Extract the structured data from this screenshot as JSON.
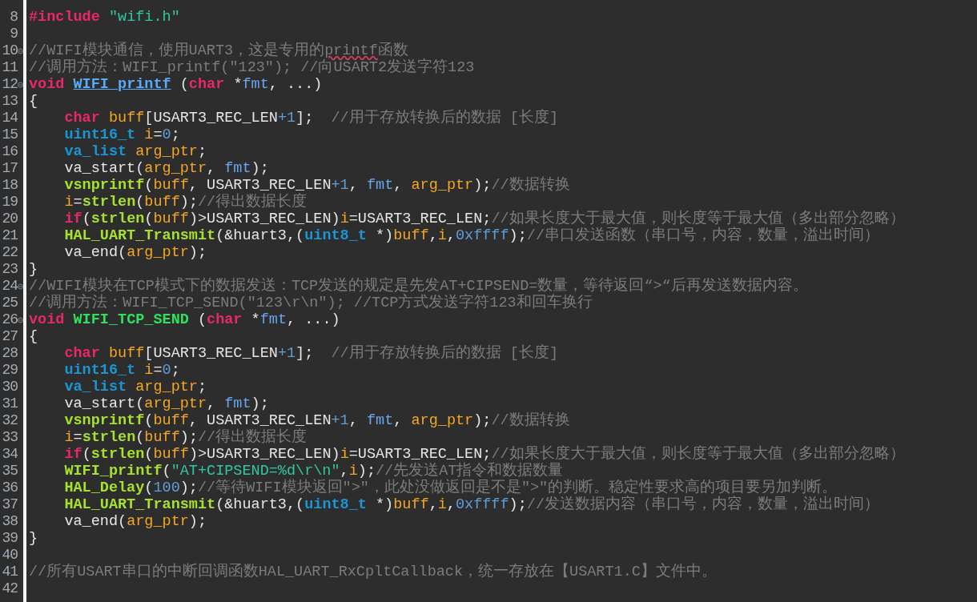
{
  "editor": {
    "lines": [
      {
        "number": "8",
        "fold": false,
        "tokens": [
          {
            "kind": "keyword",
            "text": "#include "
          },
          {
            "kind": "string",
            "text": "\"wifi.h\""
          }
        ]
      },
      {
        "number": "9",
        "fold": false
      },
      {
        "number": "10",
        "fold": true,
        "tokens": [
          {
            "kind": "comment",
            "text": "//WIFI模块通信，使用UART3，这是专用的"
          },
          {
            "kind": "misspelled",
            "text": "printf"
          },
          {
            "kind": "comment",
            "text": "函数"
          }
        ]
      },
      {
        "number": "11",
        "fold": false,
        "tokens": [
          {
            "kind": "comment",
            "text": "//调用方法：WIFI_printf(\"123\"); //向USART2发送字符123"
          }
        ]
      },
      {
        "number": "12",
        "fold": true,
        "tokens": [
          {
            "kind": "keyword",
            "text": "void "
          },
          {
            "kind": "definition-link",
            "text": "WIFI_printf"
          },
          {
            "kind": "plain",
            "text": " ("
          },
          {
            "kind": "keyword",
            "text": "char"
          },
          {
            "kind": "plain",
            "text": " *"
          },
          {
            "kind": "param",
            "text": "fmt"
          },
          {
            "kind": "plain",
            "text": ", ...)"
          }
        ]
      },
      {
        "number": "13",
        "fold": false,
        "tokens": [
          {
            "kind": "plain",
            "text": "{"
          }
        ]
      },
      {
        "number": "14",
        "fold": false,
        "indent": true,
        "tokens": [
          {
            "kind": "keyword",
            "text": "char "
          },
          {
            "kind": "variable",
            "text": "buff"
          },
          {
            "kind": "plain",
            "text": "[USART3_REC_LEN"
          },
          {
            "kind": "number",
            "text": "+1"
          },
          {
            "kind": "plain",
            "text": "];  "
          },
          {
            "kind": "comment",
            "text": "//用于存放转换后的数据 [长度]"
          }
        ]
      },
      {
        "number": "15",
        "fold": false,
        "indent": true,
        "tokens": [
          {
            "kind": "type",
            "text": "uint16_t "
          },
          {
            "kind": "variable",
            "text": "i"
          },
          {
            "kind": "plain",
            "text": "="
          },
          {
            "kind": "number",
            "text": "0"
          },
          {
            "kind": "plain",
            "text": ";"
          }
        ]
      },
      {
        "number": "16",
        "fold": false,
        "indent": true,
        "tokens": [
          {
            "kind": "type",
            "text": "va_list "
          },
          {
            "kind": "variable",
            "text": "arg_ptr"
          },
          {
            "kind": "plain",
            "text": ";"
          }
        ]
      },
      {
        "number": "17",
        "fold": false,
        "indent": true,
        "tokens": [
          {
            "kind": "plain",
            "text": "va_start("
          },
          {
            "kind": "variable",
            "text": "arg_ptr"
          },
          {
            "kind": "plain",
            "text": ", "
          },
          {
            "kind": "param",
            "text": "fmt"
          },
          {
            "kind": "plain",
            "text": ");"
          }
        ]
      },
      {
        "number": "18",
        "fold": false,
        "indent": true,
        "tokens": [
          {
            "kind": "function",
            "text": "vsnprintf"
          },
          {
            "kind": "plain",
            "text": "("
          },
          {
            "kind": "variable",
            "text": "buff"
          },
          {
            "kind": "plain",
            "text": ", USART3_REC_LEN"
          },
          {
            "kind": "number",
            "text": "+1"
          },
          {
            "kind": "plain",
            "text": ", "
          },
          {
            "kind": "param",
            "text": "fmt"
          },
          {
            "kind": "plain",
            "text": ", "
          },
          {
            "kind": "variable",
            "text": "arg_ptr"
          },
          {
            "kind": "plain",
            "text": ");"
          },
          {
            "kind": "comment",
            "text": "//数据转换"
          }
        ]
      },
      {
        "number": "19",
        "fold": false,
        "indent": true,
        "tokens": [
          {
            "kind": "variable",
            "text": "i"
          },
          {
            "kind": "plain",
            "text": "="
          },
          {
            "kind": "function",
            "text": "strlen"
          },
          {
            "kind": "plain",
            "text": "("
          },
          {
            "kind": "variable",
            "text": "buff"
          },
          {
            "kind": "plain",
            "text": ");"
          },
          {
            "kind": "comment",
            "text": "//得出数据长度"
          }
        ]
      },
      {
        "number": "20",
        "fold": false,
        "indent": true,
        "tokens": [
          {
            "kind": "keyword",
            "text": "if"
          },
          {
            "kind": "plain",
            "text": "("
          },
          {
            "kind": "function",
            "text": "strlen"
          },
          {
            "kind": "plain",
            "text": "("
          },
          {
            "kind": "variable",
            "text": "buff"
          },
          {
            "kind": "plain",
            "text": ")>USART3_REC_LEN)"
          },
          {
            "kind": "variable",
            "text": "i"
          },
          {
            "kind": "plain",
            "text": "=USART3_REC_LEN;"
          },
          {
            "kind": "comment",
            "text": "//如果长度大于最大值，则长度等于最大值（多出部分忽略）"
          }
        ]
      },
      {
        "number": "21",
        "fold": false,
        "indent": true,
        "tokens": [
          {
            "kind": "function",
            "text": "HAL_UART_Transmit"
          },
          {
            "kind": "plain",
            "text": "(&huart3,("
          },
          {
            "kind": "type",
            "text": "uint8_t"
          },
          {
            "kind": "plain",
            "text": " *)"
          },
          {
            "kind": "variable",
            "text": "buff"
          },
          {
            "kind": "plain",
            "text": ","
          },
          {
            "kind": "variable",
            "text": "i"
          },
          {
            "kind": "plain",
            "text": ","
          },
          {
            "kind": "number",
            "text": "0xffff"
          },
          {
            "kind": "plain",
            "text": ");"
          },
          {
            "kind": "comment",
            "text": "//串口发送函数（串口号，内容，数量，溢出时间）"
          }
        ]
      },
      {
        "number": "22",
        "fold": false,
        "indent": true,
        "tokens": [
          {
            "kind": "plain",
            "text": "va_end("
          },
          {
            "kind": "variable",
            "text": "arg_ptr"
          },
          {
            "kind": "plain",
            "text": ");"
          }
        ]
      },
      {
        "number": "23",
        "fold": false,
        "tokens": [
          {
            "kind": "plain",
            "text": "}"
          }
        ]
      },
      {
        "number": "24",
        "fold": true,
        "tokens": [
          {
            "kind": "comment",
            "text": "//WIFI模块在TCP模式下的数据发送：TCP发送的规定是先发AT+CIPSEND=数量，等待返回“>“后再发送数据内容。"
          }
        ]
      },
      {
        "number": "25",
        "fold": false,
        "tokens": [
          {
            "kind": "comment",
            "text": "//调用方法：WIFI_TCP_SEND(\"123\\r\\n\"); //TCP方式发送字符123和回车换行"
          }
        ]
      },
      {
        "number": "26",
        "fold": true,
        "tokens": [
          {
            "kind": "keyword",
            "text": "void "
          },
          {
            "kind": "definition",
            "text": "WIFI_TCP_SEND"
          },
          {
            "kind": "plain",
            "text": " ("
          },
          {
            "kind": "keyword",
            "text": "char"
          },
          {
            "kind": "plain",
            "text": " *"
          },
          {
            "kind": "param",
            "text": "fmt"
          },
          {
            "kind": "plain",
            "text": ", ...)"
          }
        ]
      },
      {
        "number": "27",
        "fold": false,
        "tokens": [
          {
            "kind": "plain",
            "text": "{"
          }
        ]
      },
      {
        "number": "28",
        "fold": false,
        "indent": true,
        "tokens": [
          {
            "kind": "keyword",
            "text": "char "
          },
          {
            "kind": "variable",
            "text": "buff"
          },
          {
            "kind": "plain",
            "text": "[USART3_REC_LEN"
          },
          {
            "kind": "number",
            "text": "+1"
          },
          {
            "kind": "plain",
            "text": "];  "
          },
          {
            "kind": "comment",
            "text": "//用于存放转换后的数据 [长度]"
          }
        ]
      },
      {
        "number": "29",
        "fold": false,
        "indent": true,
        "tokens": [
          {
            "kind": "type",
            "text": "uint16_t "
          },
          {
            "kind": "variable",
            "text": "i"
          },
          {
            "kind": "plain",
            "text": "="
          },
          {
            "kind": "number",
            "text": "0"
          },
          {
            "kind": "plain",
            "text": ";"
          }
        ]
      },
      {
        "number": "30",
        "fold": false,
        "indent": true,
        "tokens": [
          {
            "kind": "type",
            "text": "va_list "
          },
          {
            "kind": "variable",
            "text": "arg_ptr"
          },
          {
            "kind": "plain",
            "text": ";"
          }
        ]
      },
      {
        "number": "31",
        "fold": false,
        "indent": true,
        "tokens": [
          {
            "kind": "plain",
            "text": "va_start("
          },
          {
            "kind": "variable",
            "text": "arg_ptr"
          },
          {
            "kind": "plain",
            "text": ", "
          },
          {
            "kind": "param",
            "text": "fmt"
          },
          {
            "kind": "plain",
            "text": ");"
          }
        ]
      },
      {
        "number": "32",
        "fold": false,
        "indent": true,
        "tokens": [
          {
            "kind": "function",
            "text": "vsnprintf"
          },
          {
            "kind": "plain",
            "text": "("
          },
          {
            "kind": "variable",
            "text": "buff"
          },
          {
            "kind": "plain",
            "text": ", USART3_REC_LEN"
          },
          {
            "kind": "number",
            "text": "+1"
          },
          {
            "kind": "plain",
            "text": ", "
          },
          {
            "kind": "param",
            "text": "fmt"
          },
          {
            "kind": "plain",
            "text": ", "
          },
          {
            "kind": "variable",
            "text": "arg_ptr"
          },
          {
            "kind": "plain",
            "text": ");"
          },
          {
            "kind": "comment",
            "text": "//数据转换"
          }
        ]
      },
      {
        "number": "33",
        "fold": false,
        "indent": true,
        "tokens": [
          {
            "kind": "variable",
            "text": "i"
          },
          {
            "kind": "plain",
            "text": "="
          },
          {
            "kind": "function",
            "text": "strlen"
          },
          {
            "kind": "plain",
            "text": "("
          },
          {
            "kind": "variable",
            "text": "buff"
          },
          {
            "kind": "plain",
            "text": ");"
          },
          {
            "kind": "comment",
            "text": "//得出数据长度"
          }
        ]
      },
      {
        "number": "34",
        "fold": false,
        "indent": true,
        "tokens": [
          {
            "kind": "keyword",
            "text": "if"
          },
          {
            "kind": "plain",
            "text": "("
          },
          {
            "kind": "function",
            "text": "strlen"
          },
          {
            "kind": "plain",
            "text": "("
          },
          {
            "kind": "variable",
            "text": "buff"
          },
          {
            "kind": "plain",
            "text": ")>USART3_REC_LEN)"
          },
          {
            "kind": "variable",
            "text": "i"
          },
          {
            "kind": "plain",
            "text": "=USART3_REC_LEN;"
          },
          {
            "kind": "comment",
            "text": "//如果长度大于最大值，则长度等于最大值（多出部分忽略）"
          }
        ]
      },
      {
        "number": "35",
        "fold": false,
        "indent": true,
        "tokens": [
          {
            "kind": "function",
            "text": "WIFI_printf"
          },
          {
            "kind": "plain",
            "text": "("
          },
          {
            "kind": "string",
            "text": "\"AT+CIPSEND=%d\\r\\n\""
          },
          {
            "kind": "plain",
            "text": ","
          },
          {
            "kind": "variable",
            "text": "i"
          },
          {
            "kind": "plain",
            "text": ");"
          },
          {
            "kind": "comment",
            "text": "//先发送AT指令和数据数量"
          }
        ]
      },
      {
        "number": "36",
        "fold": false,
        "indent": true,
        "tokens": [
          {
            "kind": "function",
            "text": "HAL_Delay"
          },
          {
            "kind": "plain",
            "text": "("
          },
          {
            "kind": "number",
            "text": "100"
          },
          {
            "kind": "plain",
            "text": ");"
          },
          {
            "kind": "comment",
            "text": "//等待WIFI模块返回\">\"，此处没做返回是不是\">\"的判断。稳定性要求高的项目要另加判断。"
          }
        ]
      },
      {
        "number": "37",
        "fold": false,
        "indent": true,
        "tokens": [
          {
            "kind": "function",
            "text": "HAL_UART_Transmit"
          },
          {
            "kind": "plain",
            "text": "(&huart3,("
          },
          {
            "kind": "type",
            "text": "uint8_t"
          },
          {
            "kind": "plain",
            "text": " *)"
          },
          {
            "kind": "variable",
            "text": "buff"
          },
          {
            "kind": "plain",
            "text": ","
          },
          {
            "kind": "variable",
            "text": "i"
          },
          {
            "kind": "plain",
            "text": ","
          },
          {
            "kind": "number",
            "text": "0xffff"
          },
          {
            "kind": "plain",
            "text": ");"
          },
          {
            "kind": "comment",
            "text": "//发送数据内容（串口号，内容，数量，溢出时间）"
          }
        ]
      },
      {
        "number": "38",
        "fold": false,
        "indent": true,
        "tokens": [
          {
            "kind": "plain",
            "text": "va_end("
          },
          {
            "kind": "variable",
            "text": "arg_ptr"
          },
          {
            "kind": "plain",
            "text": ");"
          }
        ]
      },
      {
        "number": "39",
        "fold": false,
        "tokens": [
          {
            "kind": "plain",
            "text": "}"
          }
        ]
      },
      {
        "number": "40",
        "fold": false
      },
      {
        "number": "41",
        "fold": false,
        "tokens": [
          {
            "kind": "comment",
            "text": "//所有USART串口的中断回调函数HAL_UART_RxCpltCallback，统一存放在【USART1.C】文件中。"
          }
        ]
      },
      {
        "number": "42",
        "fold": false
      }
    ]
  }
}
